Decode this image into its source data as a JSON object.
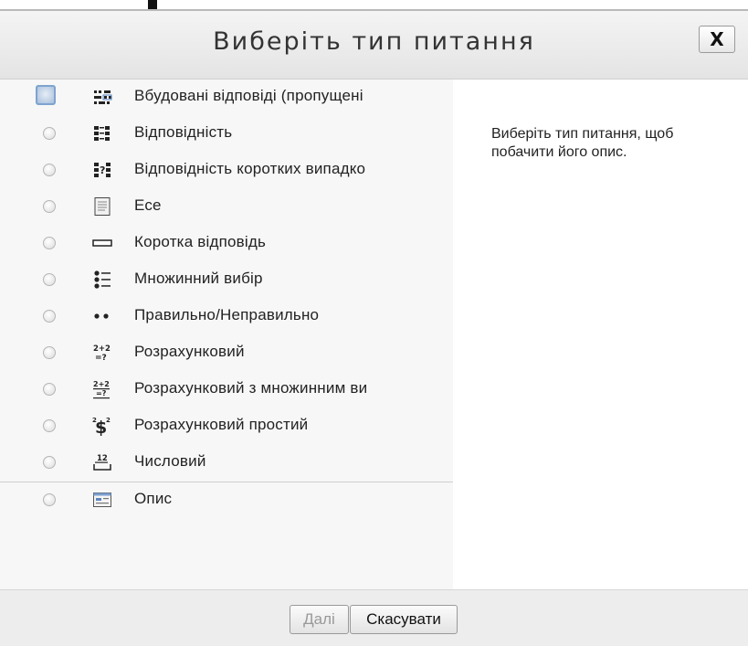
{
  "dialog": {
    "title": "Виберіть тип питання",
    "close_label": "X",
    "description": "Виберіть тип питання, щоб побачити його опис.",
    "options": [
      {
        "label": "Вбудовані відповіді (пропущені",
        "icon": "cloze-icon",
        "selected": false,
        "focused": true
      },
      {
        "label": "Відповідність",
        "icon": "matching-icon",
        "selected": false
      },
      {
        "label": "Відповідність коротких випадко",
        "icon": "random-short-answer-matching-icon",
        "selected": false
      },
      {
        "label": "Есе",
        "icon": "essay-icon",
        "selected": false
      },
      {
        "label": "Коротка відповідь",
        "icon": "short-answer-icon",
        "selected": false
      },
      {
        "label": "Множинний вибір",
        "icon": "multiple-choice-icon",
        "selected": false
      },
      {
        "label": "Правильно/Неправильно",
        "icon": "true-false-icon",
        "selected": false
      },
      {
        "label": "Розрахунковий",
        "icon": "calculated-icon",
        "selected": false
      },
      {
        "label": "Розрахунковий з множинним ви",
        "icon": "calculated-multichoice-icon",
        "selected": false
      },
      {
        "label": "Розрахунковий простий",
        "icon": "calculated-simple-icon",
        "selected": false
      },
      {
        "label": "Числовий",
        "icon": "numerical-icon",
        "selected": false
      },
      {
        "label": "Опис",
        "icon": "description-icon",
        "selected": false
      }
    ],
    "buttons": {
      "next_label": "Далі",
      "next_enabled": false,
      "cancel_label": "Скасувати"
    }
  }
}
